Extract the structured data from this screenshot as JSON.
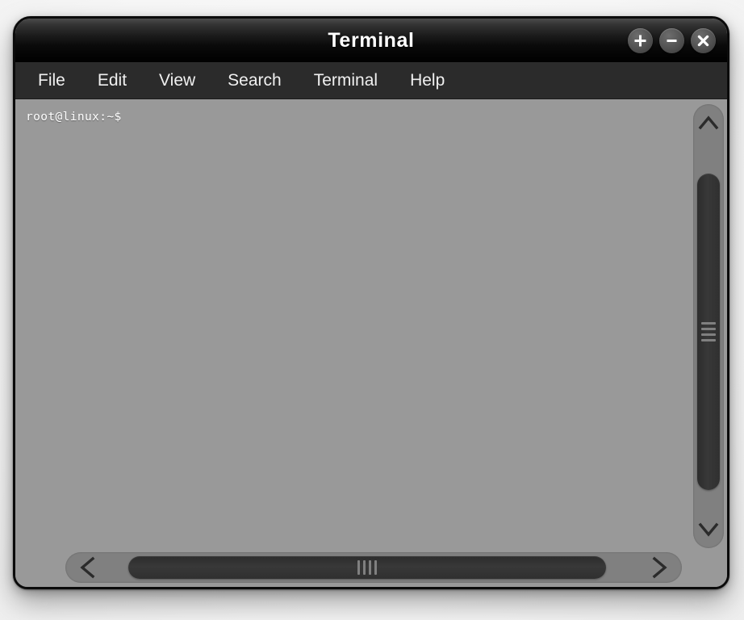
{
  "window": {
    "title": "Terminal",
    "controls": [
      {
        "name": "maximize-button",
        "icon": "plus-icon",
        "label": "+"
      },
      {
        "name": "minimize-button",
        "icon": "minus-icon",
        "label": "−"
      },
      {
        "name": "close-button",
        "icon": "close-icon",
        "label": "✕"
      }
    ]
  },
  "menubar": {
    "items": [
      {
        "label": "File"
      },
      {
        "label": "Edit"
      },
      {
        "label": "View"
      },
      {
        "label": "Search"
      },
      {
        "label": "Terminal"
      },
      {
        "label": "Help"
      }
    ]
  },
  "terminal": {
    "lines": [
      "root@linux:~$"
    ],
    "prompt_user": "root",
    "prompt_host": "linux",
    "prompt_path": "~",
    "prompt_symbol": "$",
    "background_color": "#999999",
    "text_color": "#ffffff"
  },
  "scrollbars": {
    "vertical": {
      "up_icon": "chevron-up-icon",
      "down_icon": "chevron-down-icon",
      "grip_count": 4,
      "track_color": "#808080",
      "thumb_color": "#333333"
    },
    "horizontal": {
      "left_icon": "chevron-left-icon",
      "right_icon": "chevron-right-icon",
      "grip_count": 4,
      "track_color": "#808080",
      "thumb_color": "#333333"
    }
  },
  "theme": {
    "titlebar_color": "#000000",
    "menubar_color": "#2b2b2b",
    "frame_border_color": "#0b0b0b",
    "desktop_color": "#f2f2f2"
  }
}
